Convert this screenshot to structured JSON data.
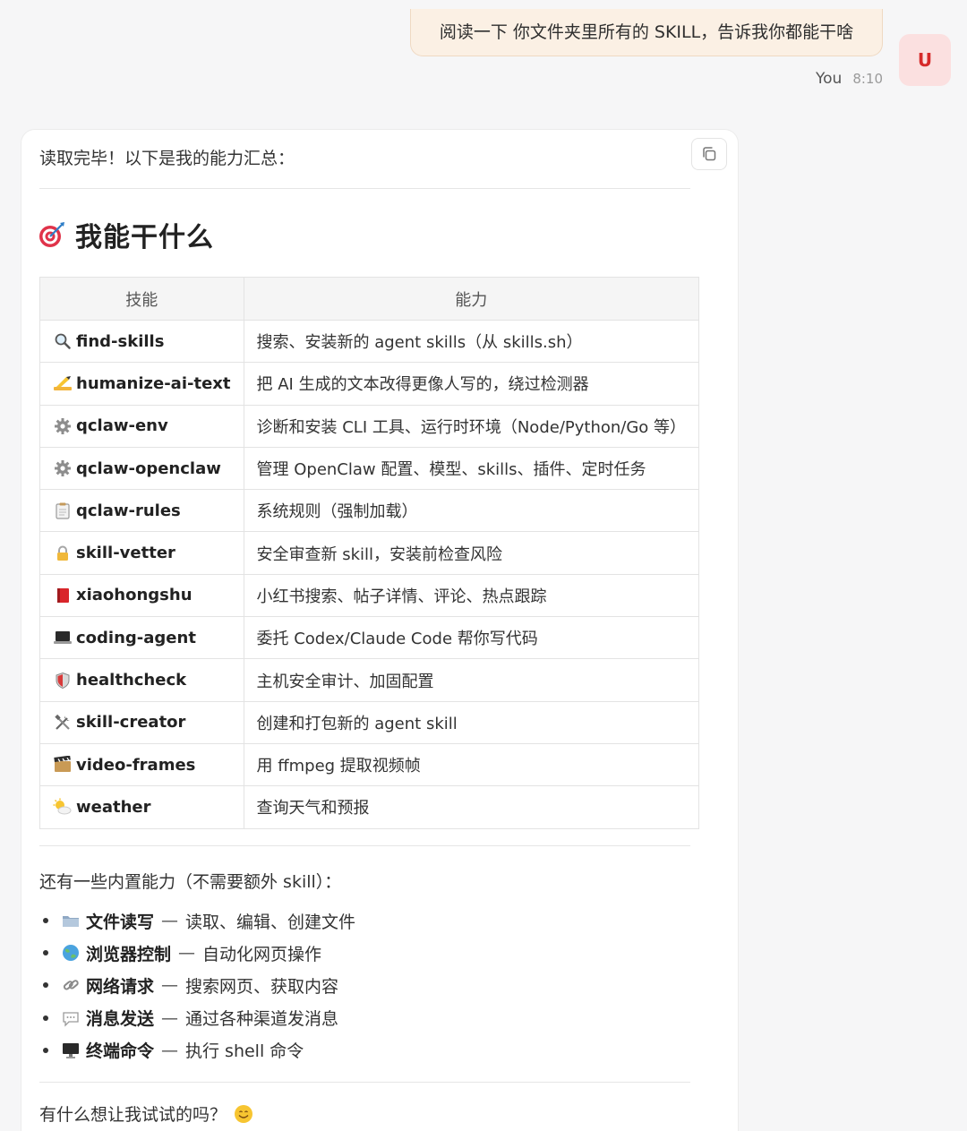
{
  "user_message": {
    "text": "阅读一下 你文件夹里所有的 SKILL，告诉我你都能干啥",
    "sender": "You",
    "time": "8:10",
    "avatar_letter": "U"
  },
  "assistant": {
    "intro": "读取完毕！以下是我的能力汇总：",
    "heading": "我能干什么",
    "table": {
      "headers": [
        "技能",
        "能力"
      ],
      "rows": [
        {
          "icon": "magnifier-icon",
          "skill": "find-skills",
          "ability": "搜索、安装新的 agent skills（从 skills.sh）"
        },
        {
          "icon": "writing-hand-icon",
          "skill": "humanize-ai-text",
          "ability": "把 AI 生成的文本改得更像人写的，绕过检测器"
        },
        {
          "icon": "gear-icon",
          "skill": "qclaw-env",
          "ability": "诊断和安装 CLI 工具、运行时环境（Node/Python/Go 等）"
        },
        {
          "icon": "gear-icon",
          "skill": "qclaw-openclaw",
          "ability": "管理 OpenClaw 配置、模型、skills、插件、定时任务"
        },
        {
          "icon": "clipboard-icon",
          "skill": "qclaw-rules",
          "ability": "系统规则（强制加载）"
        },
        {
          "icon": "lock-icon",
          "skill": "skill-vetter",
          "ability": "安全审查新 skill，安装前检查风险"
        },
        {
          "icon": "red-book-icon",
          "skill": "xiaohongshu",
          "ability": "小红书搜索、帖子详情、评论、热点跟踪"
        },
        {
          "icon": "laptop-icon",
          "skill": "coding-agent",
          "ability": "委托 Codex/Claude Code 帮你写代码"
        },
        {
          "icon": "shield-icon",
          "skill": "healthcheck",
          "ability": "主机安全审计、加固配置"
        },
        {
          "icon": "tools-icon",
          "skill": "skill-creator",
          "ability": "创建和打包新的 agent skill"
        },
        {
          "icon": "film-icon",
          "skill": "video-frames",
          "ability": "用 ffmpeg 提取视频帧"
        },
        {
          "icon": "sun-cloud-icon",
          "skill": "weather",
          "ability": "查询天气和预报"
        }
      ]
    },
    "builtin_title": "还有一些内置能力（不需要额外 skill）：",
    "builtin": [
      {
        "icon": "folder-icon",
        "name": "文件读写",
        "desc": "读取、编辑、创建文件"
      },
      {
        "icon": "globe-icon",
        "name": "浏览器控制",
        "desc": "自动化网页操作"
      },
      {
        "icon": "link-icon",
        "name": "网络请求",
        "desc": "搜索网页、获取内容"
      },
      {
        "icon": "speech-bubble-icon",
        "name": "消息发送",
        "desc": "通过各种渠道发消息"
      },
      {
        "icon": "monitor-icon",
        "name": "终端命令",
        "desc": "执行 shell 命令"
      }
    ],
    "separator": "—",
    "closing": "有什么想让我试试的吗？"
  }
}
